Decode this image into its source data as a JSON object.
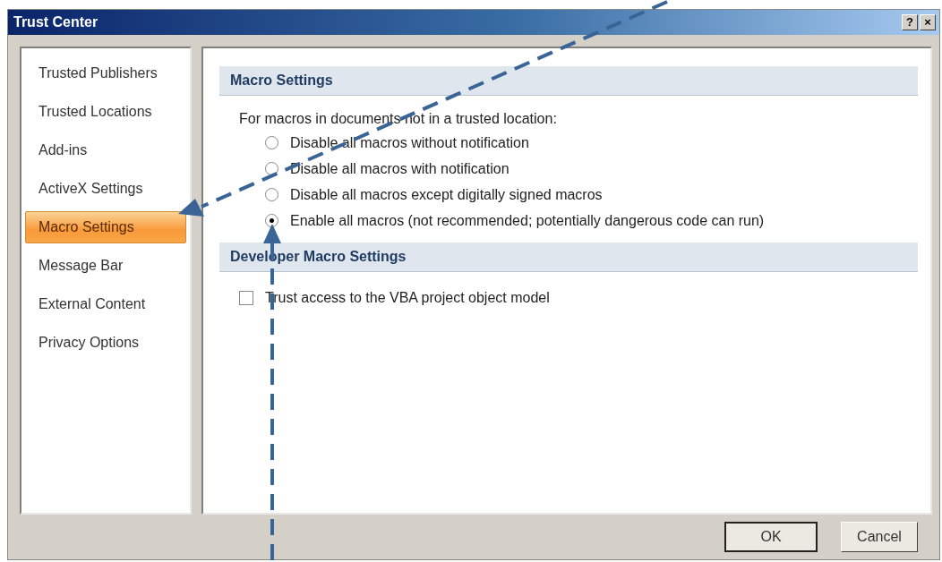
{
  "window": {
    "title": "Trust Center",
    "controls": [
      "?",
      "×"
    ]
  },
  "sidebar": {
    "items": [
      {
        "label": "Trusted Publishers",
        "selected": false
      },
      {
        "label": "Trusted Locations",
        "selected": false
      },
      {
        "label": "Add-ins",
        "selected": false
      },
      {
        "label": "ActiveX Settings",
        "selected": false
      },
      {
        "label": "Macro Settings",
        "selected": true
      },
      {
        "label": "Message Bar",
        "selected": false
      },
      {
        "label": "External Content",
        "selected": false
      },
      {
        "label": "Privacy Options",
        "selected": false
      }
    ]
  },
  "sections": [
    {
      "heading": "Macro Settings",
      "intro": "For macros in documents not in a trusted location:",
      "options": [
        {
          "kind": "radio",
          "label": "Disable all macros without notification",
          "selected": false
        },
        {
          "kind": "radio",
          "label": "Disable all macros with notification",
          "selected": false
        },
        {
          "kind": "radio",
          "label": "Disable all macros except digitally signed macros",
          "selected": false
        },
        {
          "kind": "radio",
          "label": "Enable all macros (not recommended; potentially dangerous code can run)",
          "selected": true
        }
      ]
    },
    {
      "heading": "Developer Macro Settings",
      "options": [
        {
          "kind": "checkbox",
          "label": "Trust access to the VBA project object model",
          "checked": false
        }
      ]
    }
  ],
  "buttons": [
    "OK",
    "Cancel"
  ]
}
